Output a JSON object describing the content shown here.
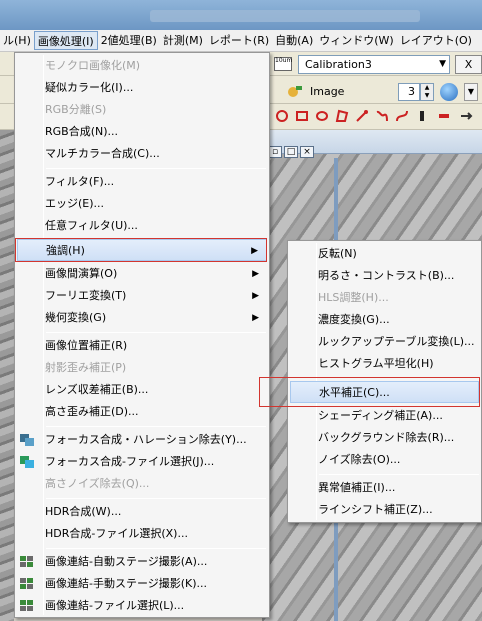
{
  "menubar": {
    "items": [
      {
        "label": "ル(H)"
      },
      {
        "label": "画像処理(I)"
      },
      {
        "label": "2値処理(B)"
      },
      {
        "label": "計測(M)"
      },
      {
        "label": "レポート(R)"
      },
      {
        "label": "自動(A)"
      },
      {
        "label": "ウィンドウ(W)"
      },
      {
        "label": "レイアウト(O)"
      }
    ]
  },
  "toolbar": {
    "calibration_icon_text": "10um",
    "calibration_value": "Calibration3",
    "close_label": "X",
    "image_label": "Image",
    "image_number": "3",
    "tools": [
      "target-icon",
      "rectangle-icon",
      "ellipse-icon",
      "polygon-icon",
      "magic-wand-icon",
      "freehand-icon",
      "curve-icon",
      "bar-icon",
      "arrow-icon"
    ]
  },
  "main_menu": {
    "items": [
      {
        "label": "モノクロ画像化(M)",
        "disabled": true
      },
      {
        "label": "疑似カラー化(I)..."
      },
      {
        "label": "RGB分離(S)",
        "disabled": true
      },
      {
        "label": "RGB合成(N)..."
      },
      {
        "label": "マルチカラー合成(C)..."
      },
      {
        "label": "フィルタ(F)..."
      },
      {
        "label": "エッジ(E)..."
      },
      {
        "label": "任意フィルタ(U)..."
      },
      {
        "label": "強調(H)",
        "submenu": true,
        "selected": true
      },
      {
        "label": "画像間演算(O)",
        "submenu": true
      },
      {
        "label": "フーリエ変換(T)",
        "submenu": true
      },
      {
        "label": "幾何変換(G)",
        "submenu": true
      },
      {
        "label": "画像位置補正(R)"
      },
      {
        "label": "射影歪み補正(P)",
        "disabled": true
      },
      {
        "label": "レンズ収差補正(B)..."
      },
      {
        "label": "高さ歪み補正(D)..."
      },
      {
        "label": "フォーカス合成・ハレーション除去(Y)..."
      },
      {
        "label": "フォーカス合成-ファイル選択(J)..."
      },
      {
        "label": "高さノイズ除去(Q)...",
        "disabled": true
      },
      {
        "label": "HDR合成(W)..."
      },
      {
        "label": "HDR合成-ファイル選択(X)..."
      },
      {
        "label": "画像連結-自動ステージ撮影(A)..."
      },
      {
        "label": "画像連結-手動ステージ撮影(K)..."
      },
      {
        "label": "画像連結-ファイル選択(L)..."
      }
    ]
  },
  "sub_menu": {
    "items": [
      {
        "label": "反転(N)"
      },
      {
        "label": "明るさ・コントラスト(B)..."
      },
      {
        "label": "HLS調整(H)...",
        "disabled": true
      },
      {
        "label": "濃度変換(G)..."
      },
      {
        "label": "ルックアップテーブル変換(L)..."
      },
      {
        "label": "ヒストグラム平坦化(H)"
      },
      {
        "label": "水平補正(C)...",
        "selected": true
      },
      {
        "label": "シェーディング補正(A)..."
      },
      {
        "label": "バックグラウンド除去(R)..."
      },
      {
        "label": "ノイズ除去(O)..."
      },
      {
        "label": "異常値補正(I)..."
      },
      {
        "label": "ラインシフト補正(Z)..."
      }
    ]
  },
  "colors": {
    "menu_bg": "#f5f5f5",
    "selection_bg": "#cfe0f6",
    "highlight_border": "#d2352f",
    "disabled_text": "#a0a0a0"
  }
}
